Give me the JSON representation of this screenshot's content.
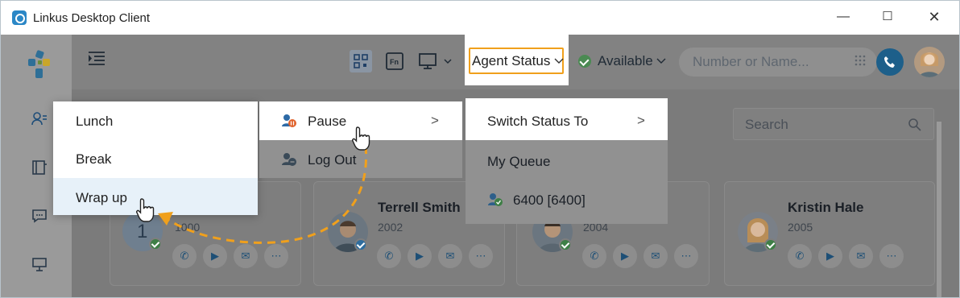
{
  "window": {
    "title": "Linkus Desktop Client"
  },
  "toolbar": {
    "agent_status_label": "Agent Status",
    "status_label": "Available",
    "search_placeholder": "Number or Name..."
  },
  "contacts_search": {
    "placeholder": "Search"
  },
  "agent_menu": {
    "items": [
      {
        "label": "Pause"
      },
      {
        "label": "Log Out"
      }
    ]
  },
  "status_menu": {
    "items": [
      {
        "label": "Switch Status To"
      },
      {
        "label": "My Queue"
      },
      {
        "label": "6400 [6400]"
      }
    ]
  },
  "pause_submenu": {
    "items": [
      {
        "label": "Lunch"
      },
      {
        "label": "Break"
      },
      {
        "label": "Wrap up"
      }
    ]
  },
  "contacts": [
    {
      "name": "",
      "ext": "1000",
      "initial": "1"
    },
    {
      "name": "Terrell Smith",
      "ext": "2002"
    },
    {
      "name": "",
      "ext": "2004"
    },
    {
      "name": "Kristin Hale",
      "ext": "2005"
    }
  ],
  "colors": {
    "accent": "#f0a01c",
    "primary": "#1d5f8a",
    "available": "#4a8a52"
  }
}
